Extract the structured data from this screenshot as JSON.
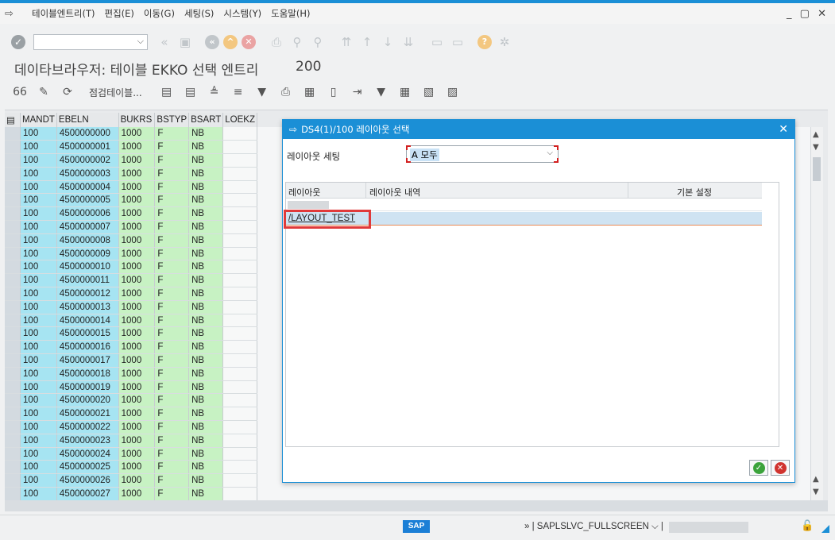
{
  "menu": {
    "items": [
      "테이블엔트리(T)",
      "편집(E)",
      "이동(G)",
      "세팅(S)",
      "시스템(Y)",
      "도움말(H)"
    ],
    "window_controls": "_ ▢ ✕"
  },
  "toolbar": {
    "command_field": ""
  },
  "page": {
    "title": "데이타브라우저: 테이블 EKKO 선택 엔트리",
    "count": "200"
  },
  "toolbar2": {
    "check_table_label": "점검테이블..."
  },
  "grid": {
    "columns": [
      "MANDT",
      "EBELN",
      "BUKRS",
      "BSTYP",
      "BSART",
      "LOEKZ"
    ],
    "rows": [
      [
        "100",
        "4500000000",
        "1000",
        "F",
        "NB",
        ""
      ],
      [
        "100",
        "4500000001",
        "1000",
        "F",
        "NB",
        ""
      ],
      [
        "100",
        "4500000002",
        "1000",
        "F",
        "NB",
        ""
      ],
      [
        "100",
        "4500000003",
        "1000",
        "F",
        "NB",
        ""
      ],
      [
        "100",
        "4500000004",
        "1000",
        "F",
        "NB",
        ""
      ],
      [
        "100",
        "4500000005",
        "1000",
        "F",
        "NB",
        ""
      ],
      [
        "100",
        "4500000006",
        "1000",
        "F",
        "NB",
        ""
      ],
      [
        "100",
        "4500000007",
        "1000",
        "F",
        "NB",
        ""
      ],
      [
        "100",
        "4500000008",
        "1000",
        "F",
        "NB",
        ""
      ],
      [
        "100",
        "4500000009",
        "1000",
        "F",
        "NB",
        ""
      ],
      [
        "100",
        "4500000010",
        "1000",
        "F",
        "NB",
        ""
      ],
      [
        "100",
        "4500000011",
        "1000",
        "F",
        "NB",
        ""
      ],
      [
        "100",
        "4500000012",
        "1000",
        "F",
        "NB",
        ""
      ],
      [
        "100",
        "4500000013",
        "1000",
        "F",
        "NB",
        ""
      ],
      [
        "100",
        "4500000014",
        "1000",
        "F",
        "NB",
        ""
      ],
      [
        "100",
        "4500000015",
        "1000",
        "F",
        "NB",
        ""
      ],
      [
        "100",
        "4500000016",
        "1000",
        "F",
        "NB",
        ""
      ],
      [
        "100",
        "4500000017",
        "1000",
        "F",
        "NB",
        ""
      ],
      [
        "100",
        "4500000018",
        "1000",
        "F",
        "NB",
        ""
      ],
      [
        "100",
        "4500000019",
        "1000",
        "F",
        "NB",
        ""
      ],
      [
        "100",
        "4500000020",
        "1000",
        "F",
        "NB",
        ""
      ],
      [
        "100",
        "4500000021",
        "1000",
        "F",
        "NB",
        ""
      ],
      [
        "100",
        "4500000022",
        "1000",
        "F",
        "NB",
        ""
      ],
      [
        "100",
        "4500000023",
        "1000",
        "F",
        "NB",
        ""
      ],
      [
        "100",
        "4500000024",
        "1000",
        "F",
        "NB",
        ""
      ],
      [
        "100",
        "4500000025",
        "1000",
        "F",
        "NB",
        ""
      ],
      [
        "100",
        "4500000026",
        "1000",
        "F",
        "NB",
        ""
      ],
      [
        "100",
        "4500000027",
        "1000",
        "F",
        "NB",
        ""
      ]
    ]
  },
  "dialog": {
    "title": "DS4(1)/100 레이아웃 선택",
    "close": "✕",
    "layout_setting_label": "레이아웃 세팅",
    "layout_setting_value": "A 모두",
    "table_headers": [
      "레이아웃",
      "레이아웃 내역",
      "기본 설정"
    ],
    "rows": [
      {
        "layout": "",
        "description": "",
        "default": ""
      },
      {
        "layout": "/LAYOUT_TEST",
        "description": "",
        "default": ""
      }
    ]
  },
  "status": {
    "logo": "SAP",
    "system": "SAPLSLVC_FULLSCREEN"
  },
  "colors": {
    "accent": "#1b8fd6",
    "key_col": "#a6e4f2",
    "data_col": "#c7f2c3",
    "highlight": "#e03a3a"
  }
}
